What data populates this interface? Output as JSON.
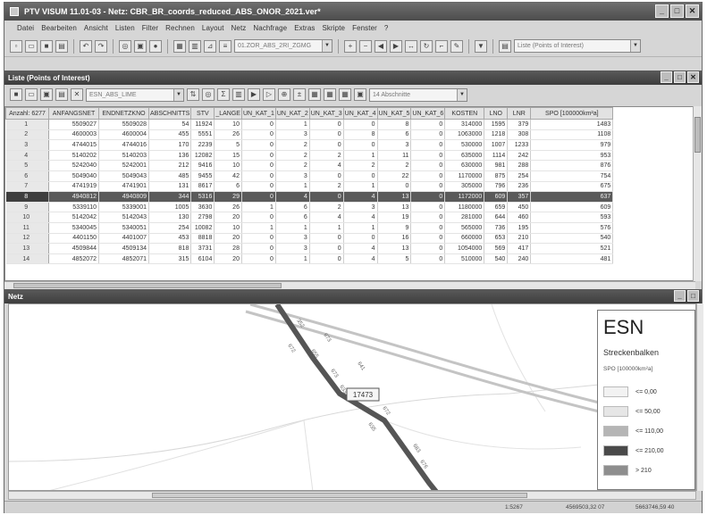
{
  "window": {
    "title": "PTV VISUM 11.01-03 - Netz: CBR_BR_coords_reduced_ABS_ONOR_2021.ver*",
    "min_label": "_",
    "max_label": "□",
    "close_label": "✕"
  },
  "menu": [
    "Datei",
    "Bearbeiten",
    "Ansicht",
    "Listen",
    "Filter",
    "Rechnen",
    "Layout",
    "Netz",
    "Nachfrage",
    "Extras",
    "Skripte",
    "Fenster",
    "?"
  ],
  "toolbar": {
    "layer_combo": "01.ZOR_ABS_2RI_ZGMG",
    "list_combo": "Liste (Points of Interest)"
  },
  "list_panel": {
    "title": "Liste (Points of Interest)",
    "layout_combo": "ESN_ABS_LIME",
    "section_combo": "14 Abschnitte",
    "columns": [
      "Anzahl: 6277",
      "ANFANGSNET",
      "ENDNETZKNO",
      "ABSCHNITTS",
      "STV",
      "_LANGE",
      "UN_KAT_1",
      "UN_KAT_2",
      "UN_KAT_3",
      "UN_KAT_4",
      "UN_KAT_5",
      "UN_KAT_6",
      "KOSTEN",
      "LNO",
      "LNR",
      "SPO [100000km²a]"
    ],
    "rows": [
      [
        "1",
        "5509027",
        "5509028",
        "54",
        "11924",
        "10",
        "0",
        "1",
        "0",
        "0",
        "8",
        "0",
        "314000",
        "1595",
        "379",
        "1483"
      ],
      [
        "2",
        "4600003",
        "4600004",
        "455",
        "5551",
        "26",
        "0",
        "3",
        "0",
        "8",
        "6",
        "0",
        "1063000",
        "1218",
        "308",
        "1108"
      ],
      [
        "3",
        "4744015",
        "4744016",
        "170",
        "2239",
        "5",
        "0",
        "2",
        "0",
        "0",
        "3",
        "0",
        "530000",
        "1007",
        "1233",
        "979"
      ],
      [
        "4",
        "5140202",
        "5140203",
        "136",
        "12082",
        "15",
        "0",
        "2",
        "2",
        "1",
        "11",
        "0",
        "635000",
        "1114",
        "242",
        "953"
      ],
      [
        "5",
        "5242040",
        "5242001",
        "212",
        "9416",
        "10",
        "0",
        "2",
        "4",
        "2",
        "2",
        "0",
        "630000",
        "981",
        "288",
        "876"
      ],
      [
        "6",
        "5049040",
        "5049043",
        "485",
        "9455",
        "42",
        "0",
        "3",
        "0",
        "0",
        "22",
        "0",
        "1170000",
        "875",
        "254",
        "754"
      ],
      [
        "7",
        "4741919",
        "4741901",
        "131",
        "8617",
        "6",
        "0",
        "1",
        "2",
        "1",
        "0",
        "0",
        "305000",
        "796",
        "236",
        "675"
      ],
      [
        "8",
        "4940812",
        "4940809",
        "344",
        "5316",
        "29",
        "0",
        "4",
        "0",
        "4",
        "13",
        "0",
        "1172000",
        "609",
        "357",
        "637"
      ],
      [
        "9",
        "5339110",
        "5339001",
        "1005",
        "3630",
        "26",
        "1",
        "6",
        "2",
        "3",
        "13",
        "0",
        "1180000",
        "659",
        "450",
        "609"
      ],
      [
        "10",
        "5142042",
        "5142043",
        "130",
        "2798",
        "20",
        "0",
        "6",
        "4",
        "4",
        "19",
        "0",
        "281000",
        "644",
        "460",
        "593"
      ],
      [
        "11",
        "5340045",
        "5340051",
        "254",
        "10082",
        "10",
        "1",
        "1",
        "1",
        "1",
        "9",
        "0",
        "565000",
        "736",
        "195",
        "576"
      ],
      [
        "12",
        "4401150",
        "4401007",
        "453",
        "8818",
        "20",
        "0",
        "3",
        "0",
        "0",
        "16",
        "0",
        "660000",
        "653",
        "210",
        "540"
      ],
      [
        "13",
        "4509844",
        "4509134",
        "818",
        "3731",
        "28",
        "0",
        "3",
        "0",
        "4",
        "13",
        "0",
        "1054000",
        "569",
        "417",
        "521"
      ],
      [
        "14",
        "4852072",
        "4852071",
        "315",
        "6104",
        "20",
        "0",
        "1",
        "0",
        "4",
        "5",
        "0",
        "510000",
        "540",
        "240",
        "481"
      ]
    ],
    "selected_row": 7
  },
  "map_panel": {
    "title": "Netz",
    "road_labels": [
      "352",
      "673",
      "672",
      "655",
      "673",
      "641",
      "633",
      "672",
      "635",
      "683",
      "676"
    ],
    "callout": "17473"
  },
  "legend": {
    "title": "ESN",
    "subtitle": "Streckenbalken",
    "unit": "SPO [100000km²a]",
    "items": [
      {
        "label": "<= 0,00",
        "color": "#f2f2f2"
      },
      {
        "label": "<= 50,00",
        "color": "#e6e6e6"
      },
      {
        "label": "<= 110,00",
        "color": "#b5b5b5"
      },
      {
        "label": "<= 210,00",
        "color": "#4a4a4a"
      },
      {
        "label": "> 210",
        "color": "#8e8e8e"
      }
    ]
  },
  "status": {
    "scale": "1:5267",
    "coord_x": "4569503,32 07",
    "coord_y": "5663746,59 40"
  }
}
